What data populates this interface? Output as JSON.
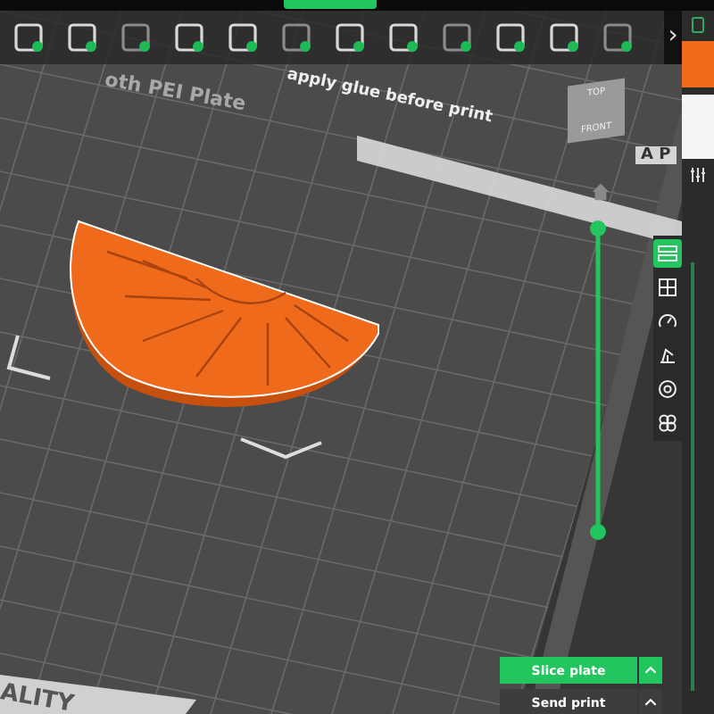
{
  "toolbar": {
    "more": "›"
  },
  "bed_labels": [
    {
      "text": "oth PEI Plate"
    },
    {
      "text": "apply glue before print"
    }
  ],
  "view_cube": {
    "top": "TOP",
    "front": "FRONT"
  },
  "corner_label": "ALITY",
  "edge_label": "A P",
  "layer_slider": {
    "level": 1
  },
  "side_tools": [
    {
      "kind": "layers",
      "selected": true
    },
    {
      "kind": "grid",
      "selected": false
    },
    {
      "kind": "speed",
      "selected": false
    },
    {
      "kind": "support",
      "selected": false
    },
    {
      "kind": "settings",
      "selected": false
    },
    {
      "kind": "fan",
      "selected": false
    }
  ],
  "actions": [
    {
      "label": "Slice plate",
      "primary": true
    },
    {
      "label": "Send print",
      "primary": false
    }
  ]
}
